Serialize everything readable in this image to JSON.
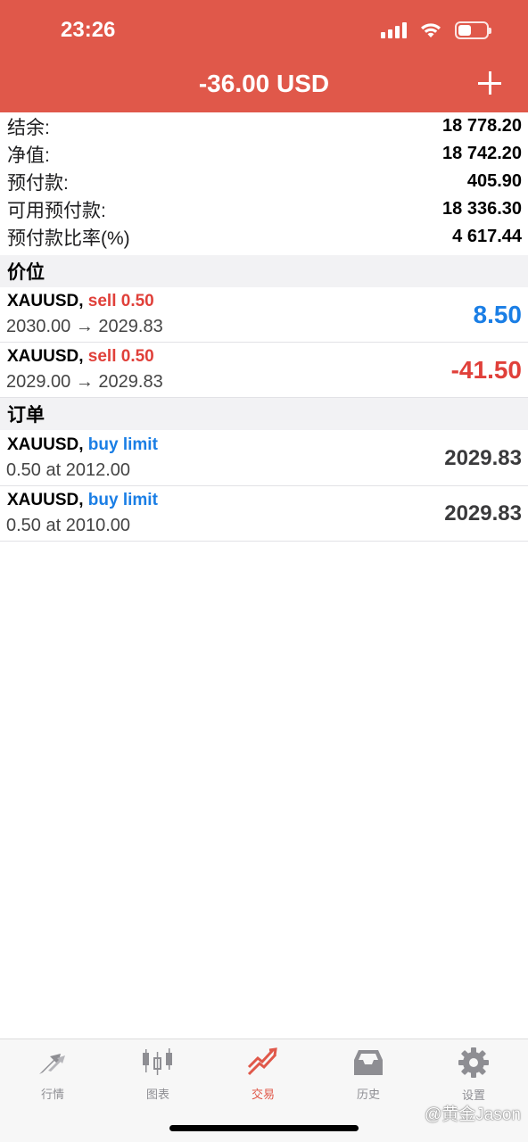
{
  "status_bar": {
    "time": "23:26"
  },
  "header": {
    "title": "-36.00 USD",
    "add_icon": "plus-icon"
  },
  "summary": [
    {
      "label": "结余:",
      "value": "18 778.20"
    },
    {
      "label": "净值:",
      "value": "18 742.20"
    },
    {
      "label": "预付款:",
      "value": "405.90"
    },
    {
      "label": "可用预付款:",
      "value": "18 336.30"
    },
    {
      "label": "预付款比率(%)",
      "value": "4 617.44"
    }
  ],
  "positions": {
    "header": "价位",
    "items": [
      {
        "symbol": "XAUUSD,",
        "action": "sell 0.50",
        "prices": "2030.00 → 2029.83",
        "profit": "8.50"
      },
      {
        "symbol": "XAUUSD,",
        "action": "sell 0.50",
        "prices": "2029.00 → 2029.83",
        "profit": "-41.50"
      }
    ]
  },
  "orders": {
    "header": "订单",
    "items": [
      {
        "symbol": "XAUUSD,",
        "action": "buy limit",
        "detail": "0.50 at 2012.00",
        "price": "2029.83"
      },
      {
        "symbol": "XAUUSD,",
        "action": "buy limit",
        "detail": "0.50 at 2010.00",
        "price": "2029.83"
      }
    ]
  },
  "tabs": [
    {
      "label": "行情",
      "icon": "quotes-arrows-icon"
    },
    {
      "label": "图表",
      "icon": "candlestick-chart-icon"
    },
    {
      "label": "交易",
      "icon": "trade-trend-icon",
      "active": true
    },
    {
      "label": "历史",
      "icon": "history-inbox-icon"
    },
    {
      "label": "设置",
      "icon": "settings-gear-icon"
    }
  ],
  "watermark": "@黄金Jason",
  "colors": {
    "header": "#e0584a",
    "profit_positive": "#1a7ee5",
    "profit_negative": "#e0403a",
    "sell": "#e0403a",
    "buy": "#1a7ee5"
  }
}
